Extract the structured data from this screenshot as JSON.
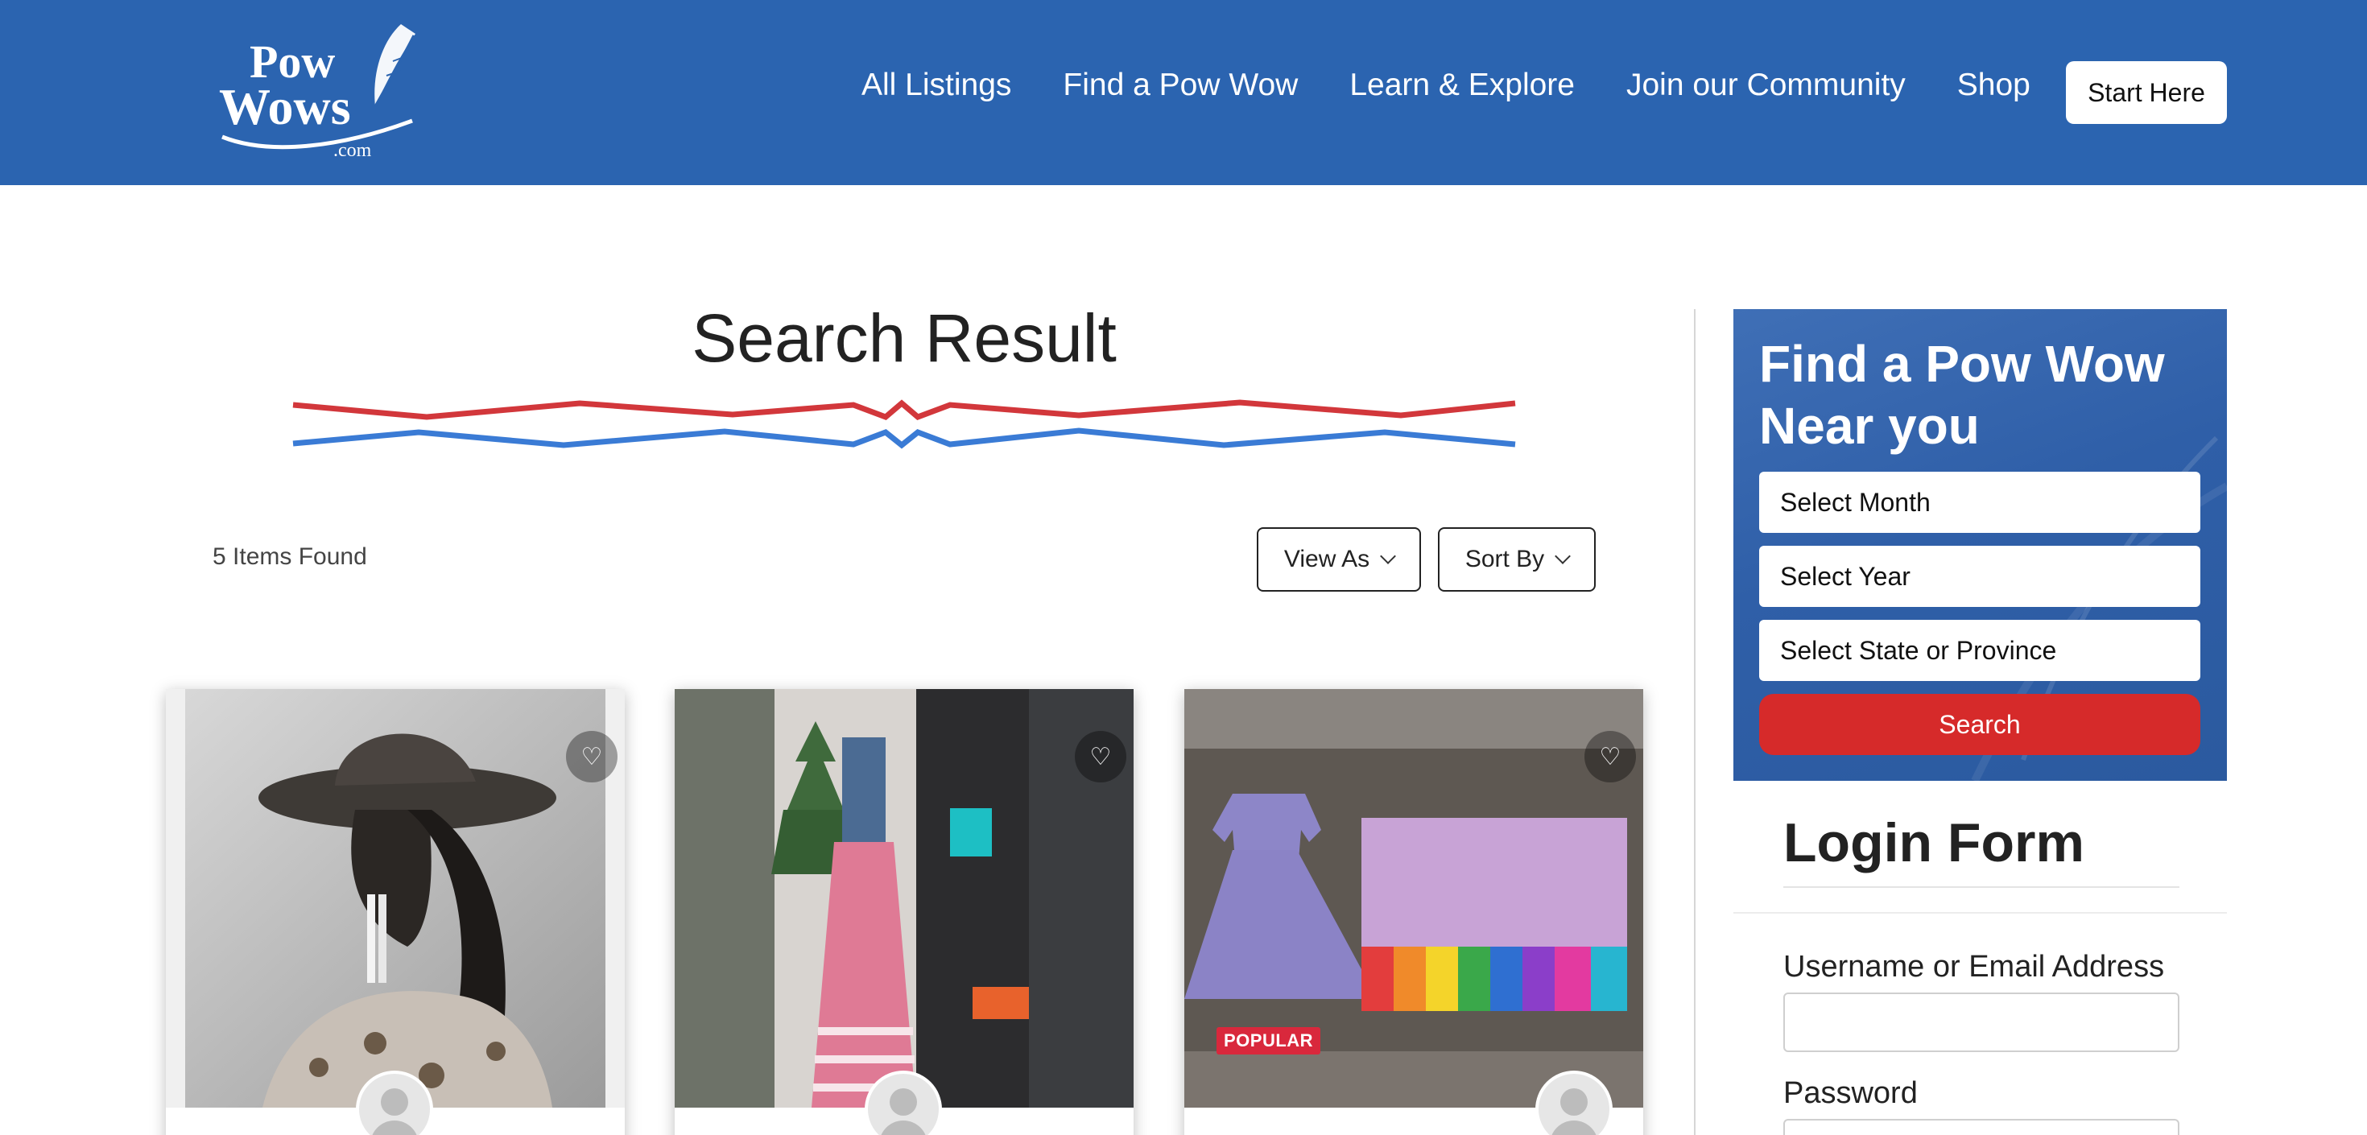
{
  "header": {
    "logo_text": [
      "Pow",
      "Wows",
      ".com"
    ],
    "nav": [
      {
        "label": "All Listings"
      },
      {
        "label": "Find a Pow Wow"
      },
      {
        "label": "Learn & Explore"
      },
      {
        "label": "Join our Community"
      },
      {
        "label": "Shop"
      }
    ],
    "start_button": "Start Here"
  },
  "main": {
    "title": "Search Result",
    "items_found": "5 Items Found",
    "view_as": "View As",
    "sort_by": "Sort By",
    "cards": [
      {
        "badge": null,
        "heart_icon": "heart-outline-icon"
      },
      {
        "badge": null,
        "heart_icon": "heart-outline-icon"
      },
      {
        "badge": "POPULAR",
        "heart_icon": "heart-outline-icon"
      }
    ]
  },
  "sidebar": {
    "finder": {
      "title": "Find a Pow Wow Near you",
      "month_placeholder": "Select Month",
      "year_placeholder": "Select Year",
      "state_placeholder": "Select State or Province",
      "search_button": "Search"
    },
    "login": {
      "title": "Login Form",
      "username_label": "Username or Email Address",
      "password_label": "Password"
    }
  },
  "colors": {
    "header_bg": "#2b64b0",
    "accent_red": "#d62a2a",
    "line_blue": "#3a7bd5",
    "badge_red": "#d9283c"
  }
}
